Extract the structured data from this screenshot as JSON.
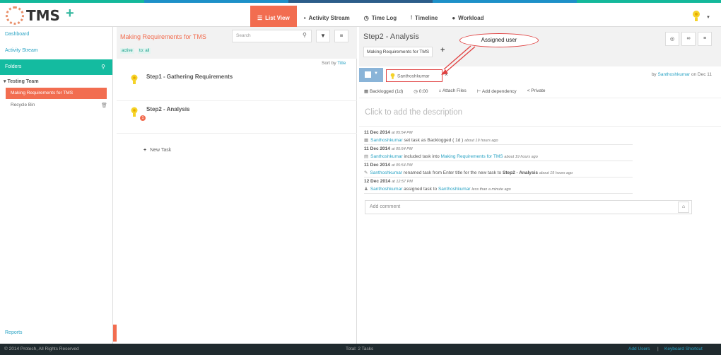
{
  "top_stripe_colors": [
    "#14b89b",
    "#1e90c8",
    "#2c5d8a",
    "#1e90c8",
    "#14b89b"
  ],
  "header": {
    "app_name": "TMS",
    "add_icon": "plus-icon",
    "tabs": [
      {
        "label": "List View",
        "icon": "list-icon",
        "active": true
      },
      {
        "label": "Activity Stream",
        "icon": "comment-icon",
        "active": false
      },
      {
        "label": "Time Log",
        "icon": "clock-icon",
        "active": false
      },
      {
        "label": "Timeline",
        "icon": "timeline-icon",
        "active": false
      },
      {
        "label": "Workload",
        "icon": "user-icon",
        "active": false
      }
    ]
  },
  "sidebar": {
    "dashboard": "Dashboard",
    "activity_stream": "Activity Stream",
    "folders": "Folders",
    "team": "Testing Team",
    "folder_active": "Making Requirements for TMS",
    "recycle_bin": "Recycle Bin",
    "reports": "Reports"
  },
  "list": {
    "title": "Making Requirements for TMS",
    "search_placeholder": "Search",
    "filters": [
      "active",
      "to: all"
    ],
    "sort_label": "Sort by",
    "sort_value": "Title",
    "tasks": [
      {
        "title": "Step1 - Gathering Requirements",
        "badge": ""
      },
      {
        "title": "Step2 - Analysis",
        "badge": "1"
      }
    ],
    "new_task": "New Task"
  },
  "detail": {
    "title": "Step2 - Analysis",
    "folder_tag": "Making Requirements for TMS",
    "assigned_user": "Santhoshkumar",
    "by_prefix": "by",
    "by_user": "Santhoshkumar",
    "by_suffix": "on Dec 11",
    "meta": [
      "Backlogged (1d)",
      "0:00",
      "Attach Files",
      "Add dependency",
      "Private"
    ],
    "description_placeholder": "Click to add the description",
    "activities": [
      {
        "date": "11 Dec 2014",
        "time": "at 05:54 PM",
        "user": "Santhoshkumar",
        "text": "set task as Backlogged ( 1d )",
        "link": "",
        "ago": "about 19 hours ago"
      },
      {
        "date": "11 Dec 2014",
        "time": "at 05:54 PM",
        "user": "Santhoshkumar",
        "text": "included task into",
        "link": "Making Requirements for TMS",
        "ago": "about 19 hours ago"
      },
      {
        "date": "11 Dec 2014",
        "time": "at 05:54 PM",
        "user": "Santhoshkumar",
        "text": "renamed task from Enter title for the new task to",
        "link": "Step2 - Analysis",
        "ago": "about 19 hours ago"
      },
      {
        "date": "12 Dec 2014",
        "time": "at 12:57 PM",
        "user": "Santhoshkumar",
        "text": "assigned task to",
        "link": "Santhoshkumar",
        "ago": "less than a minute ago"
      }
    ],
    "comment_placeholder": "Add comment"
  },
  "callout": "Assigned user",
  "footer": {
    "copyright": "© 2014 Protech, All Rights Reserved",
    "total": "Total: 2 Tasks",
    "add_users": "Add Users",
    "separator": "|",
    "shortcut": "Keyboard Shortcut"
  }
}
